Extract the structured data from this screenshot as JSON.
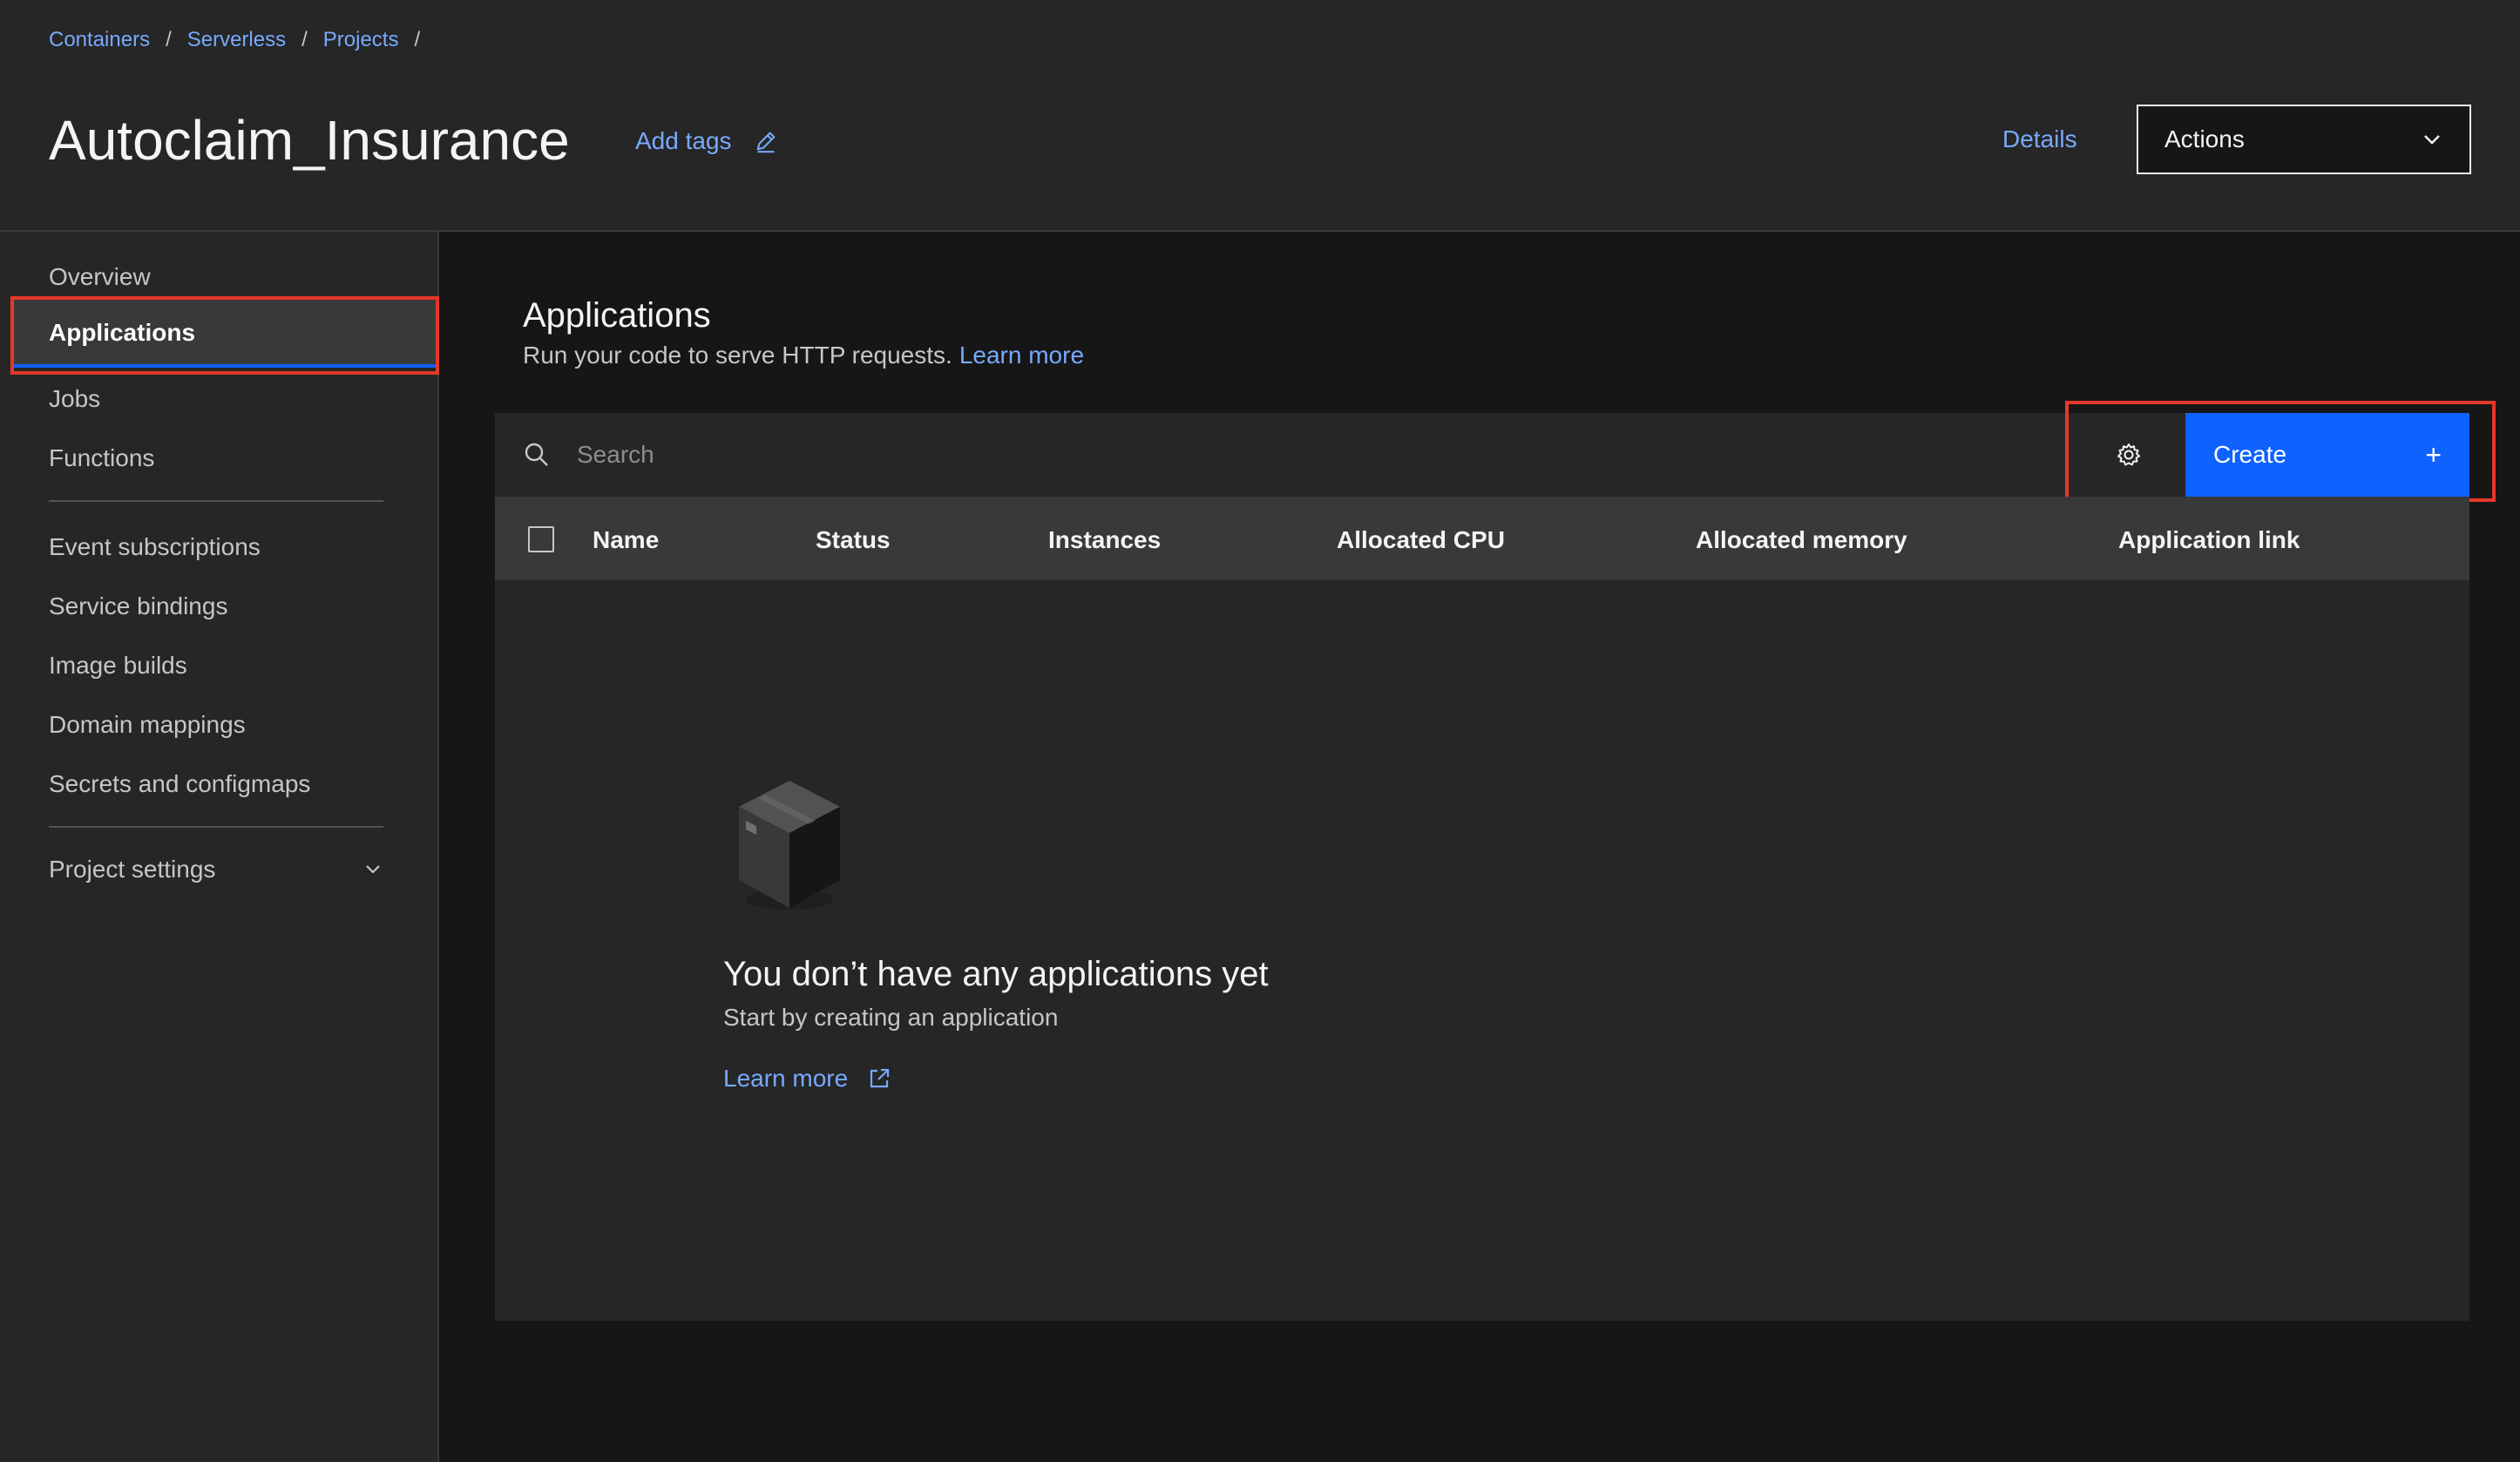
{
  "breadcrumb": [
    {
      "label": "Containers"
    },
    {
      "label": "Serverless"
    },
    {
      "label": "Projects"
    }
  ],
  "breadcrumb_separator": "/",
  "header": {
    "title": "Autoclaim_Insurance",
    "add_tags_label": "Add tags",
    "details_label": "Details",
    "actions_label": "Actions"
  },
  "sidebar": {
    "items": [
      {
        "label": "Overview"
      },
      {
        "label": "Applications",
        "active": true
      },
      {
        "label": "Jobs"
      },
      {
        "label": "Functions"
      },
      {
        "label": "Event subscriptions"
      },
      {
        "label": "Service bindings"
      },
      {
        "label": "Image builds"
      },
      {
        "label": "Domain mappings"
      },
      {
        "label": "Secrets and configmaps"
      }
    ],
    "project_settings_label": "Project settings"
  },
  "main": {
    "title": "Applications",
    "description": "Run your code to serve HTTP requests.",
    "description_link": "Learn more",
    "search_placeholder": "Search",
    "create_label": "Create",
    "create_icon": "+",
    "table_columns": [
      "Name",
      "Status",
      "Instances",
      "Allocated CPU",
      "Allocated memory",
      "Application link"
    ],
    "empty_state": {
      "title": "You don’t have any applications yet",
      "subtitle": "Start by creating an application",
      "link_label": "Learn more"
    }
  },
  "colors": {
    "accent": "#0f62fe",
    "link": "#78a9ff",
    "highlight": "#e5382a"
  }
}
